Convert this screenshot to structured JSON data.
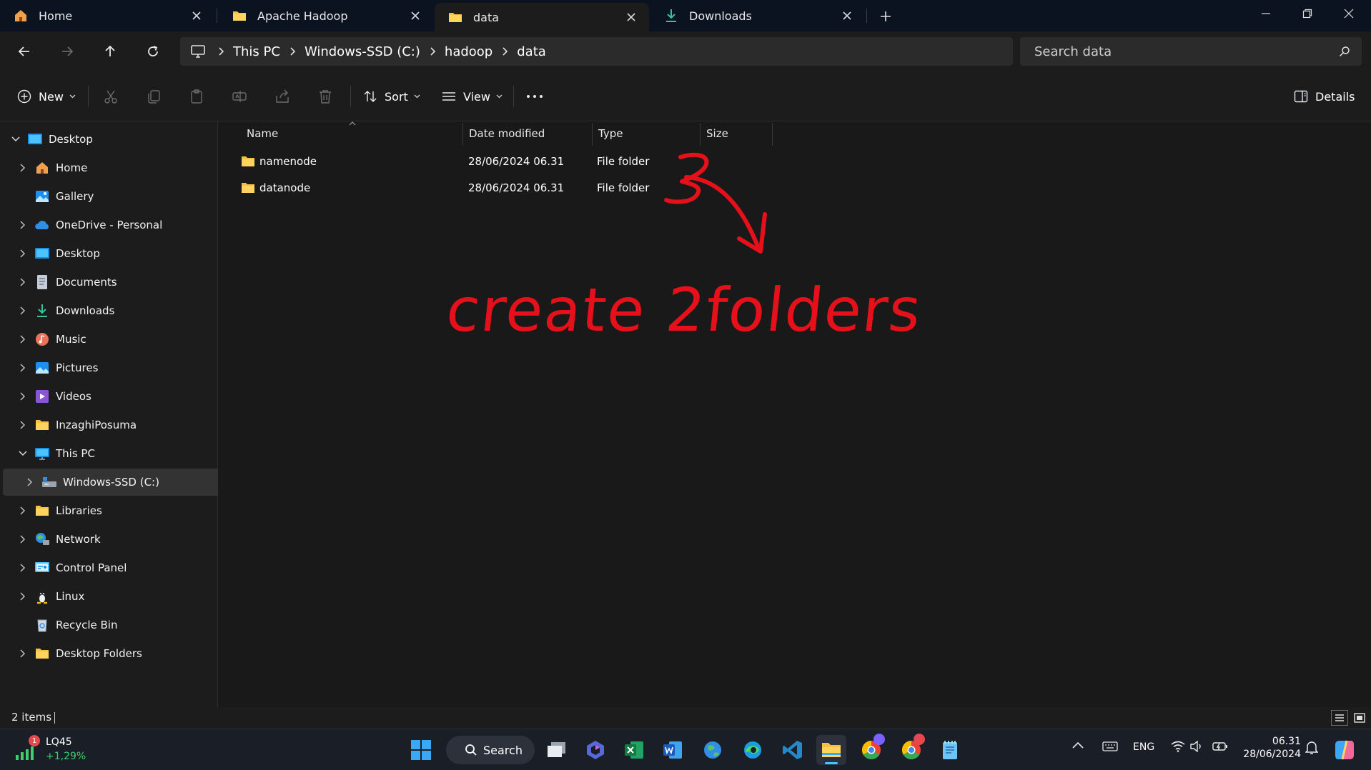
{
  "tabs": [
    {
      "label": "Home",
      "icon": "home-icon",
      "active": false
    },
    {
      "label": "Apache Hadoop",
      "icon": "folder-icon",
      "active": false
    },
    {
      "label": "data",
      "icon": "folder-icon",
      "active": true
    },
    {
      "label": "Downloads",
      "icon": "download-icon",
      "active": false
    }
  ],
  "address": {
    "crumbs": [
      "This PC",
      "Windows-SSD (C:)",
      "hadoop",
      "data"
    ],
    "search_placeholder": "Search data"
  },
  "toolbar": {
    "new_label": "New",
    "sort_label": "Sort",
    "view_label": "View",
    "details_label": "Details"
  },
  "sidebar": {
    "items": [
      {
        "label": "Desktop",
        "icon": "desktop-icon"
      },
      {
        "label": "Home",
        "icon": "home-icon"
      },
      {
        "label": "Gallery",
        "icon": "gallery-icon"
      },
      {
        "label": "OneDrive - Personal",
        "icon": "onedrive-icon"
      },
      {
        "label": "Desktop",
        "icon": "desktop-icon"
      },
      {
        "label": "Documents",
        "icon": "documents-icon"
      },
      {
        "label": "Downloads",
        "icon": "download-icon"
      },
      {
        "label": "Music",
        "icon": "music-icon"
      },
      {
        "label": "Pictures",
        "icon": "pictures-icon"
      },
      {
        "label": "Videos",
        "icon": "videos-icon"
      },
      {
        "label": "InzaghiPosuma",
        "icon": "folder-icon"
      },
      {
        "label": "This PC",
        "icon": "pc-icon"
      },
      {
        "label": "Windows-SSD (C:)",
        "icon": "drive-icon"
      },
      {
        "label": "Libraries",
        "icon": "folder-icon"
      },
      {
        "label": "Network",
        "icon": "network-icon"
      },
      {
        "label": "Control Panel",
        "icon": "control-panel-icon"
      },
      {
        "label": "Linux",
        "icon": "linux-icon"
      },
      {
        "label": "Recycle Bin",
        "icon": "recycle-bin-icon"
      },
      {
        "label": "Desktop Folders",
        "icon": "folder-icon"
      }
    ]
  },
  "columns": {
    "name": "Name",
    "date": "Date modified",
    "type": "Type",
    "size": "Size"
  },
  "files": [
    {
      "name": "namenode",
      "date": "28/06/2024 06.31",
      "type": "File folder",
      "size": ""
    },
    {
      "name": "datanode",
      "date": "28/06/2024 06.31",
      "type": "File folder",
      "size": ""
    }
  ],
  "annotation": {
    "text": "create 2folders",
    "color": "#e5101a"
  },
  "status": {
    "items_count": "2 items"
  },
  "taskbar": {
    "stock": {
      "ticker": "LQ45",
      "change": "+1,29%",
      "badge": "1"
    },
    "search_label": "Search",
    "tray": {
      "language": "ENG",
      "time": "06.31",
      "date": "28/06/2024"
    }
  },
  "colors": {
    "accent": "#0078d4",
    "folder": "#f4c144",
    "stock_up": "#3ecf6c"
  }
}
